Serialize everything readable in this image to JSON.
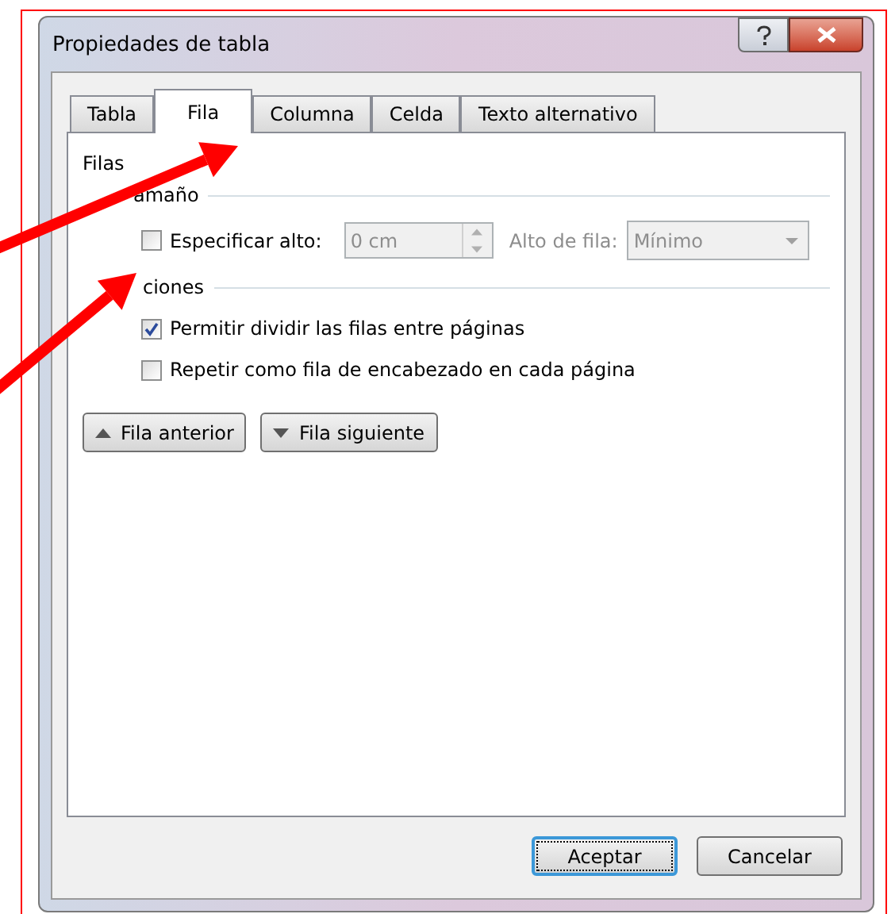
{
  "window": {
    "title": "Propiedades de tabla"
  },
  "tabs": [
    {
      "label": "Tabla",
      "selected": false
    },
    {
      "label": "Fila",
      "selected": true
    },
    {
      "label": "Columna",
      "selected": false
    },
    {
      "label": "Celda",
      "selected": false
    },
    {
      "label": "Texto alternativo",
      "selected": false
    }
  ],
  "heading": "Filas",
  "size_group": {
    "title": "amaño",
    "specify": {
      "label": "Especificar alto:",
      "checked": false
    },
    "height_field": {
      "value": "0 cm",
      "disabled": true
    },
    "row_height_label": {
      "label": "Alto de fila:",
      "disabled": true
    },
    "row_height_select": {
      "value": "Mínimo",
      "disabled": true
    }
  },
  "options_group": {
    "title": "ciones",
    "options": [
      {
        "label": "Permitir dividir las filas entre páginas",
        "checked": true
      },
      {
        "label": "Repetir como fila de encabezado en cada página",
        "checked": false
      }
    ]
  },
  "nav_buttons": [
    {
      "label": "Fila anterior",
      "kind": "up"
    },
    {
      "label": "Fila siguiente",
      "kind": "down"
    }
  ],
  "buttons": [
    {
      "label": "Aceptar",
      "default": true
    },
    {
      "label": "Cancelar",
      "default": false
    }
  ]
}
